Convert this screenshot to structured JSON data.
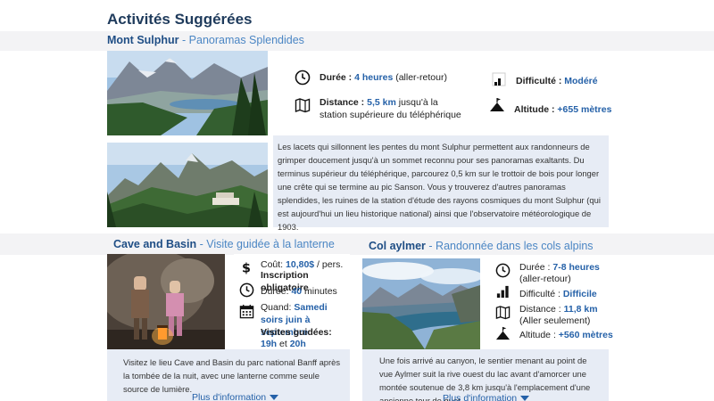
{
  "page_title": "Activités Suggérées",
  "sulphur": {
    "name": "Mont Sulphur",
    "subtitle": "- Panoramas Splendides",
    "duration_label": "Durée : ",
    "duration_value": "4 heures",
    "duration_note": " (aller-retour)",
    "distance_label": "Distance : ",
    "distance_value": "5,5 km",
    "distance_note": " jusqu'à la station supérieure du téléphérique",
    "difficulty_label": "Difficulté : ",
    "difficulty_value": "Modéré",
    "altitude_label": "Altitude : ",
    "altitude_value": "+655 mètres",
    "description": "Les lacets qui sillonnent les pentes du mont Sulphur permettent aux randonneurs de grimper doucement jusqu'à un sommet reconnu pour ses panoramas exaltants. Du terminus supérieur du téléphérique, parcourez 0,5 km sur le trottoir de bois pour longer une crête qui se termine au pic Sanson. Vous y trouverez d'autres panoramas splendides, les ruines de la station d'étude des rayons cosmiques du mont Sulphur (qui est aujourd'hui un lieu historique national) ainsi que l'observatoire météorologique de 1903."
  },
  "cave": {
    "name": "Cave and Basin",
    "subtitle": "- Visite guidée à la lanterne",
    "cost_label": "Coût: ",
    "cost_value": "10,80$",
    "cost_note": " / pers.",
    "registration": "Inscription obligatoire",
    "duration_label": "Durée: ",
    "duration_value": "40",
    "duration_note": " minutes",
    "when_label": "Quand: ",
    "when_value": "Samedi soirs juin à septembre",
    "visits_label": "Visites guidées:",
    "visit_time_1": "19h",
    "visits_and": " et ",
    "visit_time_2": "20h",
    "description": "Visitez le lieu Cave and Basin du parc national Banff après la tombée de la nuit, avec une lanterne comme seule source de lumière.",
    "more": "Plus d'information"
  },
  "aylmer": {
    "name": "Col aylmer",
    "subtitle": "- Randonnée dans les cols alpins",
    "duration_label": "Durée : ",
    "duration_value": "7-8 heures",
    "duration_note": "(aller-retour)",
    "difficulty_label": "Difficulté : ",
    "difficulty_value": "Difficile",
    "distance_label": "Distance : ",
    "distance_value": "11,8 km",
    "distance_note": "(Aller seulement)",
    "altitude_label": "Altitude : ",
    "altitude_value": "+560 mètres",
    "description": "Une fois arrivé au canyon, le sentier menant au point de vue Aylmer suit la rive ouest du lac avant d'amorcer une montée soutenue de 3,8 km jusqu'à l'emplacement d'une ancienne tour de guet.",
    "more": "Plus d'information"
  },
  "colors": {
    "title": "#1f3b5c",
    "accent": "#2561a8",
    "band": "#f3f3f5",
    "panel": "#e7ecf5"
  },
  "icons": [
    "clock-icon",
    "map-icon",
    "signal-bars-icon",
    "mountain-peak-icon",
    "dollar-icon",
    "calendar-icon"
  ]
}
